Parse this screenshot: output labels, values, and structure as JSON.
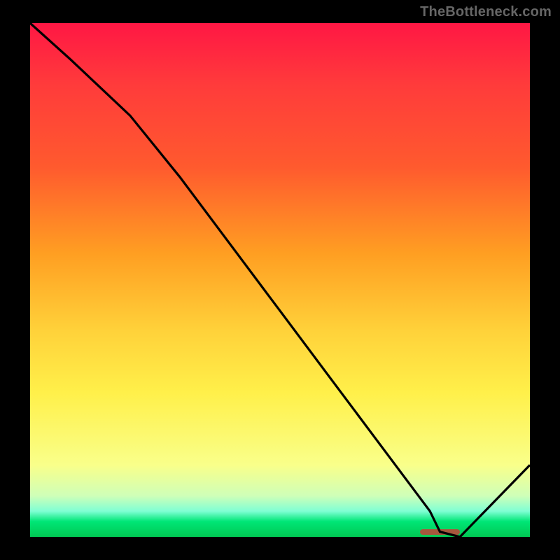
{
  "watermark": "TheBottleneck.com",
  "chart_data": {
    "type": "line",
    "title": "",
    "xlabel": "",
    "ylabel": "",
    "xlim": [
      0,
      100
    ],
    "ylim": [
      0,
      100
    ],
    "grid": false,
    "legend": false,
    "background": "rainbow-gradient",
    "series": [
      {
        "name": "curve",
        "x": [
          0,
          8,
          20,
          30,
          40,
          50,
          60,
          70,
          80,
          82,
          86,
          94,
          100
        ],
        "values": [
          100,
          93,
          82,
          70,
          57,
          44,
          31,
          18,
          5,
          1,
          0,
          8,
          14
        ]
      }
    ],
    "marker": {
      "x_start": 78,
      "x_end": 88,
      "y": 0,
      "color": "#b74a3a"
    }
  }
}
